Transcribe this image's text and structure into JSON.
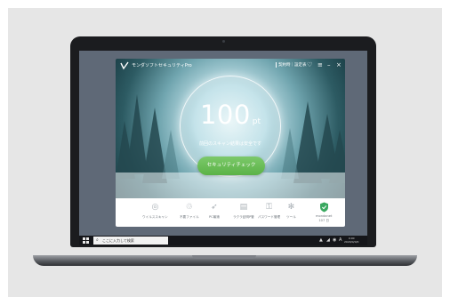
{
  "app": {
    "title": "モンダソフトセキュリティPro",
    "account_link": "契約時｜設定表"
  },
  "titlebar_icons": [
    "shield-outline-icon",
    "menu-icon",
    "minimize-icon",
    "close-icon"
  ],
  "titlebar_glyphs": {
    "shield": "♡",
    "menu": "≡",
    "minimize": "–",
    "close": "×"
  },
  "score": {
    "value": "100",
    "unit": "pt",
    "caption": "前回のスキャン結果は安全です"
  },
  "main_button": {
    "label": "セキュリティチェック"
  },
  "toolbar": {
    "items": [
      {
        "label": "ウイルススキャン",
        "icon": "radar-icon",
        "glyph": "◎"
      },
      {
        "label": "不要ファイル",
        "icon": "trash-icon",
        "glyph": "♲"
      },
      {
        "label": "PC最適",
        "icon": "rocket-icon",
        "glyph": "➶"
      },
      {
        "label": "ラクラ証明P管",
        "icon": "document-icon",
        "glyph": "▤"
      },
      {
        "label": "パスワード管理",
        "icon": "key-icon",
        "glyph": "⚿"
      },
      {
        "label": "ツール",
        "icon": "gear-icon",
        "glyph": "✻"
      }
    ],
    "status": {
      "label": "mondanet",
      "sublabel": "107 日",
      "icon": "shield-check-icon"
    }
  },
  "taskbar": {
    "search_placeholder": "ここに入力して検索",
    "tray_glyphs": [
      "▲",
      "◢",
      "◉",
      "A"
    ],
    "clock_time": "0:00",
    "clock_date": "2020/0/0/0"
  },
  "colors": {
    "accent_green": "#5bb247",
    "taskbar": "#15161a",
    "shield_green": "#3aa860"
  }
}
